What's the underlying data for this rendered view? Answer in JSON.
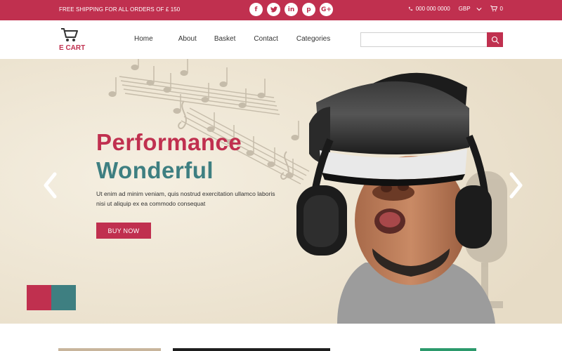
{
  "topbar": {
    "shipping_text": "FREE SHIPPING FOR ALL ORDERS OF £ 150",
    "socials": [
      "f",
      "t",
      "in",
      "p",
      "G+"
    ],
    "phone": "000 000 0000",
    "currency": "GBP",
    "cart_count": "0"
  },
  "header": {
    "logo_text": "E CART",
    "nav": [
      "Home",
      "About",
      "Basket",
      "Contact",
      "Categories"
    ],
    "search_placeholder": ""
  },
  "hero": {
    "headline_1": "Performance",
    "headline_2": "Wonderful",
    "description": "Ut enim ad minim veniam, quis nostrud exercitation ullamco laboris nisi ut aliquip ex ea commodo consequat",
    "cta": "BUY NOW"
  },
  "colors": {
    "brand": "#c0304f",
    "accent": "#3e7f81",
    "hero_bg": "#efe7d6"
  }
}
